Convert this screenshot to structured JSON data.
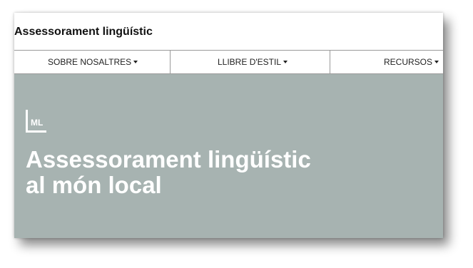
{
  "header": {
    "title": "Assessorament lingüístic"
  },
  "nav": {
    "items": [
      {
        "label": "SOBRE NOSALTRES",
        "icon": "caret-down-icon"
      },
      {
        "label": "LLIBRE D'ESTIL",
        "icon": "caret-down-icon"
      },
      {
        "label": "RECURSOS",
        "icon": "caret-down-icon"
      }
    ]
  },
  "hero": {
    "logo_text": "ML",
    "title_line1": "Assessorament lingüístic",
    "title_line2": "al món local"
  },
  "colors": {
    "hero_background": "#a7b3b1",
    "hero_text": "#ffffff",
    "nav_border": "#9a9a9a"
  }
}
